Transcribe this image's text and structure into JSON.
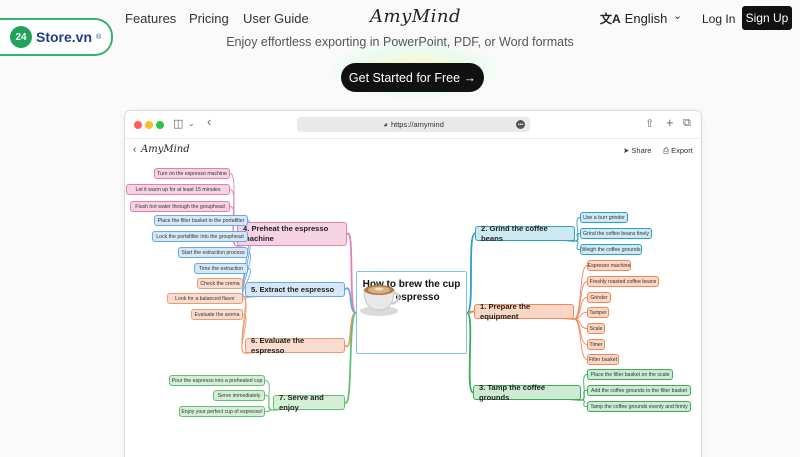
{
  "nav": {
    "links": [
      "Features",
      "Pricing",
      "User Guide"
    ],
    "logo": "AmyMind",
    "language": "English",
    "login": "Log In",
    "signup": "Sign Up"
  },
  "badge": {
    "number": "24",
    "text": "Store.vn",
    "mark": "®"
  },
  "hero": {
    "subtitle": "Enjoy effortless exporting in PowerPoint, PDF, or Word formats",
    "cta": "Get Started for Free →"
  },
  "browser": {
    "url": "https://amymind",
    "app_logo": "AmyMind",
    "share": "Share",
    "export": "Export"
  },
  "mindmap": {
    "center": "How to brew the cup of espresso",
    "branches": [
      {
        "title": "4. Preheat the espresso machine",
        "color": "#e57fb3",
        "fill": "#f6d3e3",
        "leaves": [
          "Turn on the espresso machine",
          "Let it warm up for at least 15 minutes",
          "Flush hot water through the grouphead"
        ]
      },
      {
        "title": "5. Extract the espresso",
        "color": "#6aa8dd",
        "fill": "#d6e7f7",
        "leaves": [
          "Place the filter basket in the portafilter",
          "Lock the portafilter into the grouphead",
          "Start the extraction process",
          "Time the extraction"
        ]
      },
      {
        "title": "6. Evaluate the espresso",
        "color": "#ec9a72",
        "fill": "#f9dccd",
        "leaves": [
          "Check the crema",
          "Look for a balanced flavor",
          "Evaluate the aroma"
        ]
      },
      {
        "title": "7. Serve and enjoy",
        "color": "#64bf73",
        "fill": "#d4efd6",
        "leaves": [
          "Pour the espresso into a preheated cup",
          "Serve immediately",
          "Enjoy your perfect cup of espresso!"
        ]
      },
      {
        "title": "2. Grind the coffee beans",
        "color": "#2e9fc4",
        "fill": "#cfe9f3",
        "leaves": [
          "Use a burr grinder",
          "Grind the coffee beans finely",
          "Weigh the coffee grounds"
        ]
      },
      {
        "title": "1. Prepare the equipment",
        "color": "#ec8a5c",
        "fill": "#fad6c4",
        "leaves": [
          "Espresso machine",
          "Freshly roasted coffee beans",
          "Grinder",
          "Tamper",
          "Scale",
          "Timer",
          "Filter basket"
        ]
      },
      {
        "title": "3. Tamp the coffee grounds",
        "color": "#3dab5a",
        "fill": "#cdebd3",
        "leaves": [
          "Place the filter basket on the scale",
          "Add the coffee grounds to the filter basket",
          "Tamp the coffee grounds evenly and firmly"
        ]
      }
    ]
  }
}
